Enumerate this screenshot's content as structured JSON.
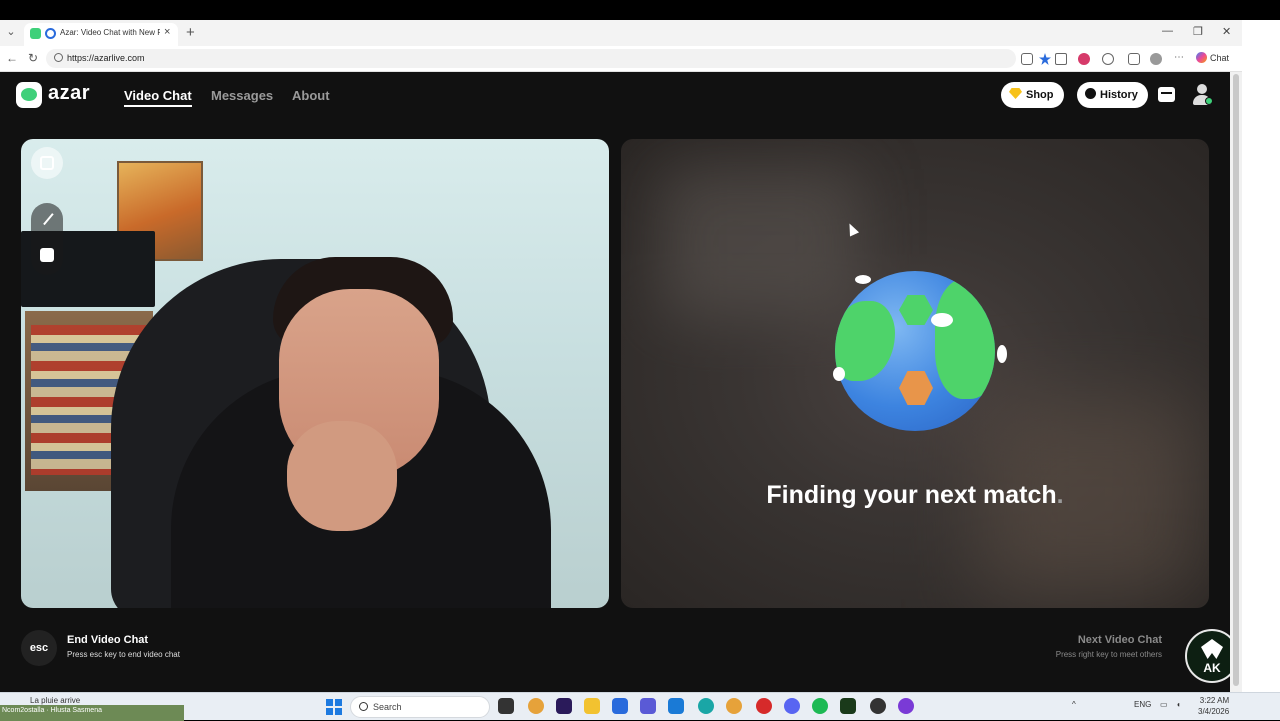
{
  "browser": {
    "tab_title": "Azar: Video Chat with New People",
    "url": "https://azarlive.com",
    "chat_label": "Chat",
    "tab_close": "×",
    "new_tab": "+"
  },
  "header": {
    "brand": "azar",
    "nav": [
      "Video Chat",
      "Messages",
      "About"
    ],
    "shop_label": "Shop",
    "history_label": "History"
  },
  "match_panel": {
    "status_text": "Finding your next match",
    "status_dot": "."
  },
  "controls": {
    "esc_key": "esc",
    "end_title": "End Video Chat",
    "end_subtitle": "Press esc key to end video chat",
    "next_title": "Next Video Chat",
    "next_subtitle": "Press right key to meet others"
  },
  "watermark": {
    "text": "AK"
  },
  "taskbar": {
    "weather": "La pluie arrive",
    "ticker": "Ncom2ostalla · Hlusta Sasmena",
    "search_placeholder": "Search",
    "language": "ENG",
    "time": "3:22 AM",
    "date": "3/4/2026"
  },
  "colors": {
    "accent_green": "#3fd07a",
    "page_bg": "#111111"
  }
}
